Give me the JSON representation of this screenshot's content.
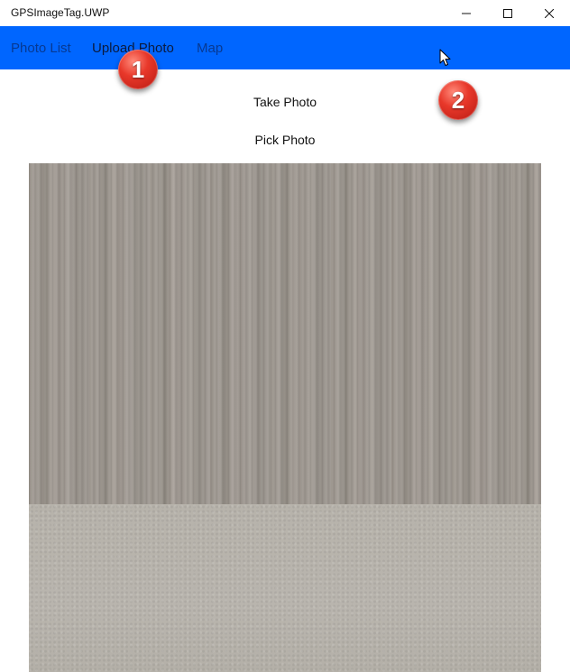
{
  "window": {
    "title": "GPSImageTag.UWP",
    "controls": {
      "minimize_icon": "minimize-icon",
      "maximize_icon": "maximize-icon",
      "close_icon": "close-icon"
    }
  },
  "nav": {
    "background": "#0066ff",
    "items": [
      {
        "label": "Photo List",
        "active": false
      },
      {
        "label": "Upload Photo",
        "active": true
      },
      {
        "label": "Map",
        "active": false
      }
    ]
  },
  "annotations": [
    {
      "label": "1"
    },
    {
      "label": "2"
    }
  ],
  "actions": {
    "take_photo": "Take Photo",
    "pick_photo": "Pick Photo"
  },
  "photo": {
    "description_icon": "photo-preview-image"
  }
}
